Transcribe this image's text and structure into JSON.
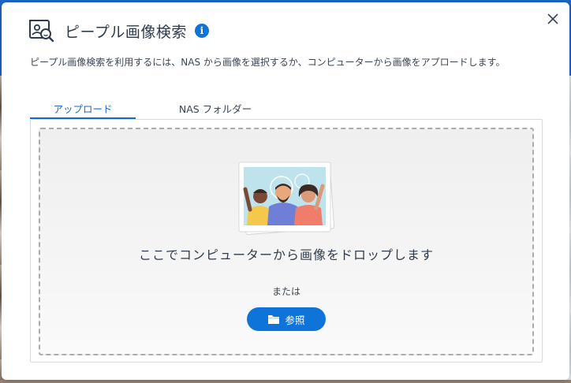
{
  "dialog": {
    "title": "ピープル画像検索",
    "info_icon": "i",
    "description": "ピープル画像検索を利用するには、NAS から画像を選択するか、コンピューターから画像をアプロードします。"
  },
  "tabs": [
    {
      "label": "アップロード",
      "active": true
    },
    {
      "label": "NAS フォルダー",
      "active": false
    }
  ],
  "dropzone": {
    "drop_text": "ここでコンピューターから画像をドロップします",
    "or_text": "または",
    "browse_label": "参照"
  },
  "colors": {
    "accent": "#0f74d9",
    "title_text": "#2f3b4a",
    "background_topbar": "#1e67c9"
  },
  "icons": {
    "app": "people-search-icon",
    "info": "info-icon",
    "close": "close-icon",
    "browse": "folder-icon",
    "illustration": "people-photo-illustration"
  }
}
